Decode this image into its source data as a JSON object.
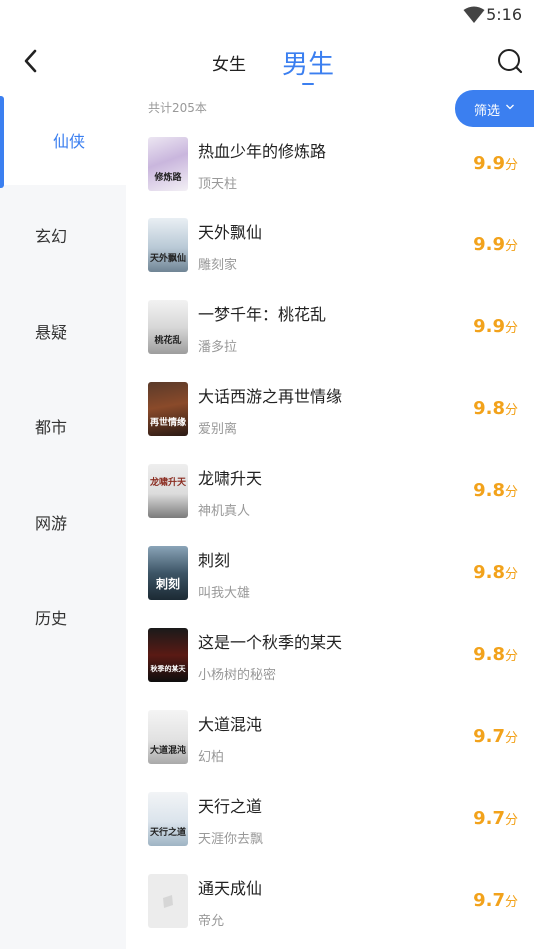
{
  "status_bar": {
    "time": "5:16",
    "wifi_icon": "wifi-icon"
  },
  "nav": {
    "tab_female": "女生",
    "tab_male": "男生",
    "active_tab": "男生",
    "back_icon": "chevron-left-icon",
    "search_icon": "search-icon"
  },
  "colors": {
    "accent": "#3b7ff0",
    "score": "#f2a21b",
    "sidebar_bg": "#f6f7f9"
  },
  "sidebar": {
    "items": [
      {
        "label": "仙侠"
      },
      {
        "label": "玄幻"
      },
      {
        "label": "悬疑"
      },
      {
        "label": "都市"
      },
      {
        "label": "网游"
      },
      {
        "label": "历史"
      }
    ],
    "active": "仙侠"
  },
  "list": {
    "count_text": "共计205本",
    "filter_label": "筛选",
    "score_unit": "分",
    "books": [
      {
        "title": "热血少年的修炼路",
        "author": "顶天柱",
        "score": "9.9",
        "cover_text": "修炼路"
      },
      {
        "title": "天外飘仙",
        "author": "雕刻家",
        "score": "9.9",
        "cover_text": "天外飘仙"
      },
      {
        "title": "一梦千年：桃花乱",
        "author": "潘多拉",
        "score": "9.9",
        "cover_text": "桃花乱"
      },
      {
        "title": "大话西游之再世情缘",
        "author": "爱别离",
        "score": "9.8",
        "cover_text": "再世情缘"
      },
      {
        "title": "龙啸升天",
        "author": "神机真人",
        "score": "9.8",
        "cover_text": "龙啸升天"
      },
      {
        "title": "刺刻",
        "author": "叫我大雄",
        "score": "9.8",
        "cover_text": "刺刻"
      },
      {
        "title": "这是一个秋季的某天",
        "author": "小杨树的秘密",
        "score": "9.8",
        "cover_text": "秋季的某天"
      },
      {
        "title": "大道混沌",
        "author": "幻柏",
        "score": "9.7",
        "cover_text": "大道混沌"
      },
      {
        "title": "天行之道",
        "author": "天涯你去飘",
        "score": "9.7",
        "cover_text": "天行之道"
      },
      {
        "title": "通天成仙",
        "author": "帝允",
        "score": "9.7",
        "cover_text": ""
      }
    ]
  }
}
